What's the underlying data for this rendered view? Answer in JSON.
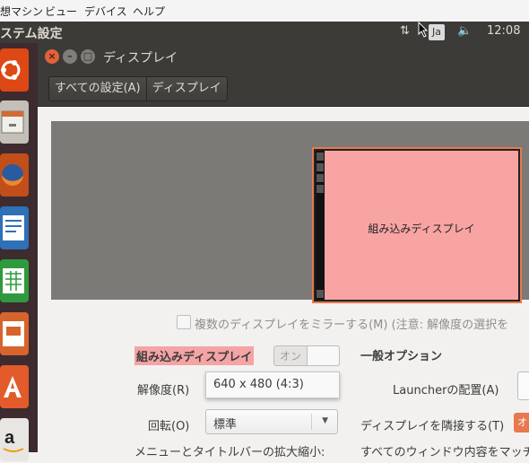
{
  "menubar": {
    "items": [
      "想マシン",
      "ビュー",
      "デバイス",
      "ヘルプ"
    ]
  },
  "top_panel": {
    "title": "ステム設定",
    "keyboard_layout": "Ja",
    "clock": "12:08"
  },
  "launcher": {
    "icons": [
      "ubuntu-icon",
      "file-manager-icon",
      "firefox-icon",
      "writer-icon",
      "calc-icon",
      "impress-icon",
      "software-center-icon",
      "amazon-icon"
    ]
  },
  "window": {
    "title": "ディスプレイ"
  },
  "breadcrumbs": {
    "all_settings": "すべての設定(A)",
    "current": "ディスプレイ"
  },
  "arrangement": {
    "monitor_label": "組み込みディスプレイ"
  },
  "mirror": {
    "label": "複数のディスプレイをミラーする(M) (注意: 解像度の選択を",
    "checked": false
  },
  "display_settings": {
    "display_name": "組み込みディスプレイ",
    "switch_label": "オン",
    "resolution_label": "解像度(R)",
    "resolution_value": "640 x 480 (4:3)",
    "rotation_label": "回転(O)",
    "rotation_value": "標準",
    "scale_label": "メニューとタイトルバーの拡大縮小:"
  },
  "general_options": {
    "title": "一般オプション",
    "launcher_placement_label": "Launcherの配置(A)",
    "sticky_edges_label": "ディスプレイを隣接する(T)",
    "sticky_edges_value": "オ",
    "scale_all_label": "すべてのウィンドウ内容をマッチ"
  },
  "colors": {
    "accent": "#e8784d",
    "selection": "#f4a4a4",
    "panel": "#3c3b37"
  }
}
